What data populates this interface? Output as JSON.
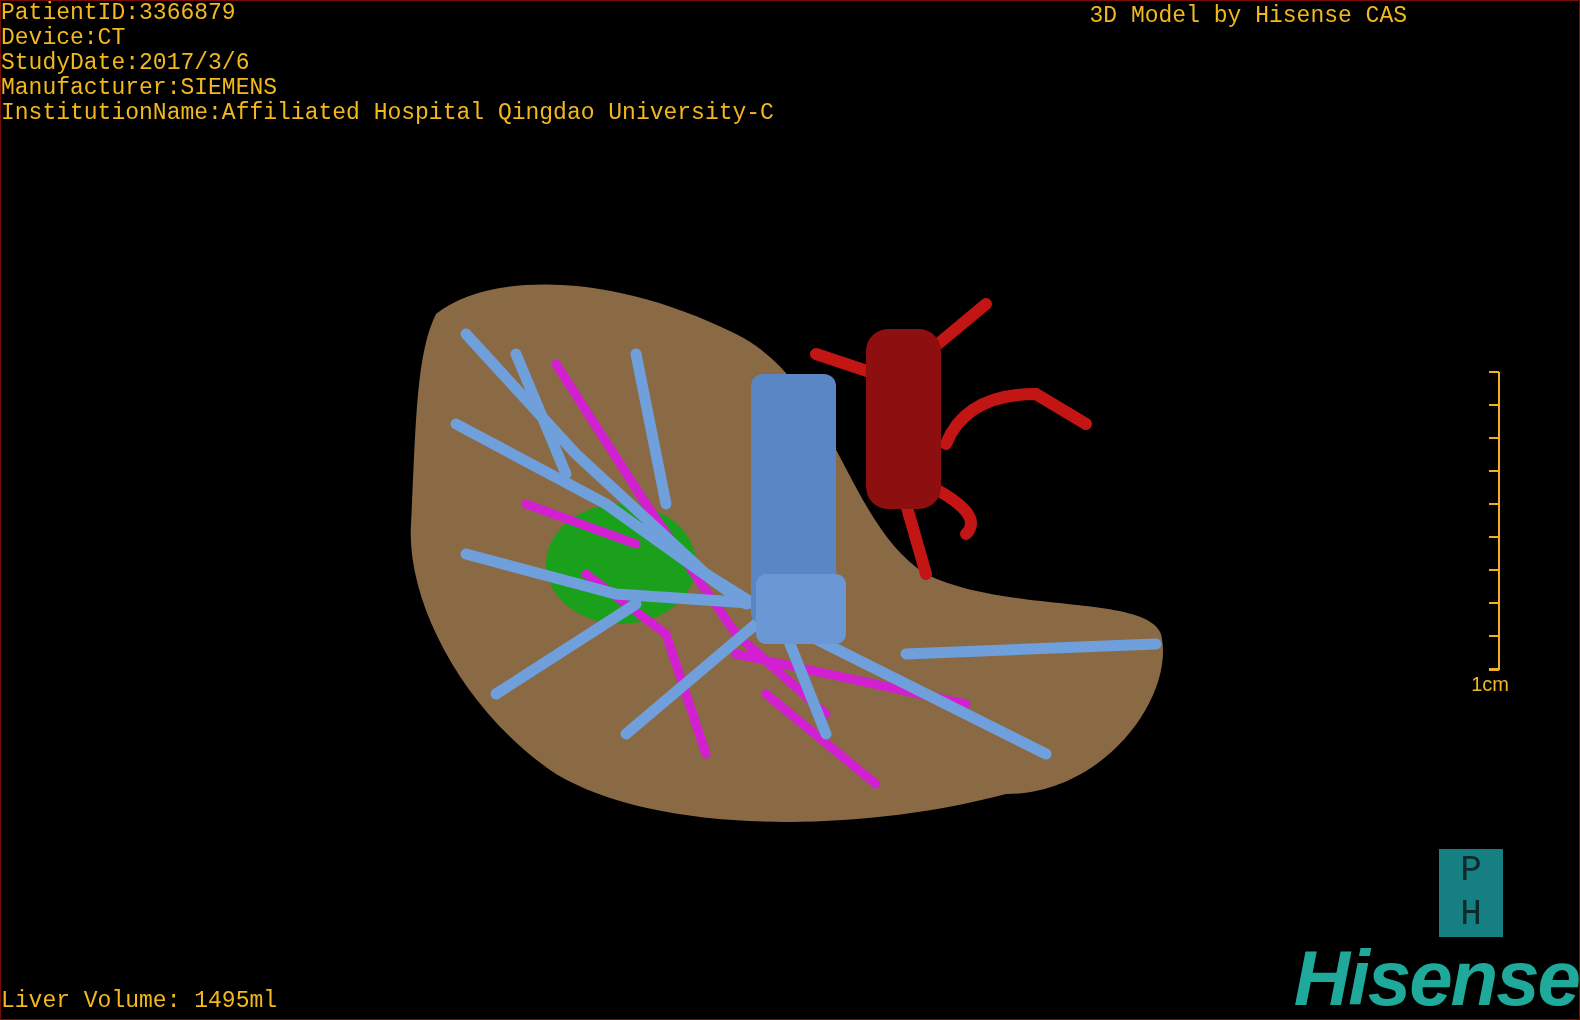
{
  "info_lines": [
    "PatientID:3366879",
    "Device:CT",
    "StudyDate:2017/3/6",
    "Manufacturer:SIEMENS",
    "InstitutionName:Affiliated Hospital Qingdao University-C"
  ],
  "title": "3D Model by Hisense CAS",
  "scale_bar": {
    "label": "1cm"
  },
  "volume": "Liver Volume: 1495ml",
  "logo": {
    "box_letters": [
      "P",
      "H"
    ],
    "wordmark": "Hisense"
  }
}
